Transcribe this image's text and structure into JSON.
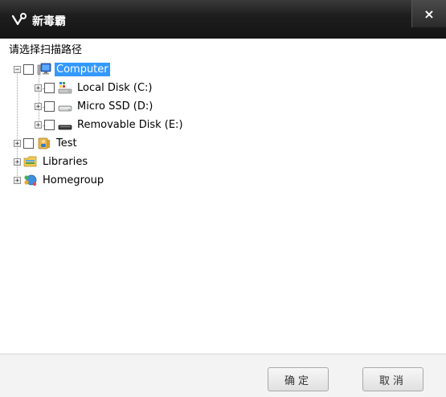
{
  "window": {
    "title": "新毒霸",
    "close_label": "×"
  },
  "prompt": "请选择扫描路径",
  "tree": {
    "computer": {
      "label": "Computer",
      "expander": "−",
      "selected": true
    },
    "local_disk": {
      "label": "Local Disk (C:)",
      "expander": "+"
    },
    "micro_ssd": {
      "label": "Micro SSD (D:)",
      "expander": "+"
    },
    "removable_disk": {
      "label": "Removable Disk (E:)",
      "expander": "+"
    },
    "test": {
      "label": "Test",
      "expander": "+"
    },
    "libraries": {
      "label": "Libraries",
      "expander": "+"
    },
    "homegroup": {
      "label": "Homegroup",
      "expander": "+"
    }
  },
  "buttons": {
    "ok_label": "确定",
    "cancel_label": "取消"
  },
  "colors": {
    "selection": "#3399ff",
    "titlebar": "#1e1e1e"
  }
}
